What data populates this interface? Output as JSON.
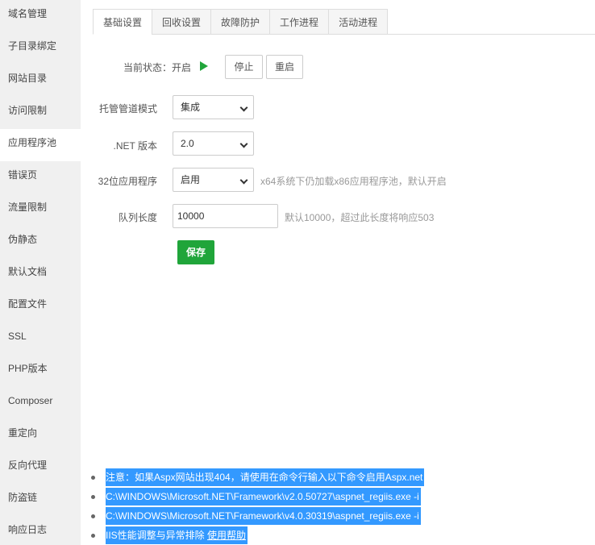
{
  "sidebar": {
    "items": [
      {
        "label": "域名管理"
      },
      {
        "label": "子目录绑定"
      },
      {
        "label": "网站目录"
      },
      {
        "label": "访问限制"
      },
      {
        "label": "应用程序池",
        "active": true
      },
      {
        "label": "错误页"
      },
      {
        "label": "流量限制"
      },
      {
        "label": "伪静态"
      },
      {
        "label": "默认文档"
      },
      {
        "label": "配置文件"
      },
      {
        "label": "SSL"
      },
      {
        "label": "PHP版本"
      },
      {
        "label": "Composer"
      },
      {
        "label": "重定向"
      },
      {
        "label": "反向代理"
      },
      {
        "label": "防盗链"
      },
      {
        "label": "响应日志"
      }
    ]
  },
  "tabs": [
    {
      "label": "基础设置",
      "active": true
    },
    {
      "label": "回收设置"
    },
    {
      "label": "故障防护"
    },
    {
      "label": "工作进程"
    },
    {
      "label": "活动进程"
    }
  ],
  "form": {
    "status_label": "当前状态：",
    "status_value": "开启",
    "stop_label": "停止",
    "restart_label": "重启",
    "pipeline_label": "托管管道模式",
    "pipeline_value": "集成",
    "net_label": ".NET 版本",
    "net_value": "2.0",
    "bit32_label": "32位应用程序",
    "bit32_value": "启用",
    "bit32_hint": "x64系统下仍加载x86应用程序池，默认开启",
    "queue_label": "队列长度",
    "queue_value": "10000",
    "queue_hint": "默认10000，超过此长度将响应503",
    "save_label": "保存"
  },
  "notes": {
    "line1": "注意：如果Aspx网站出现404，请使用在命令行输入以下命令启用Aspx.net",
    "line2": "C:\\WINDOWS\\Microsoft.NET\\Framework\\v2.0.50727\\aspnet_regiis.exe -i",
    "line3": "C:\\WINDOWS\\Microsoft.NET\\Framework\\v4.0.30319\\aspnet_regiis.exe -i",
    "line4_text": "IIS性能调整与异常排除 ",
    "line4_link": "使用帮助"
  },
  "colors": {
    "accent": "#20a53a",
    "selection": "#3399ff"
  }
}
